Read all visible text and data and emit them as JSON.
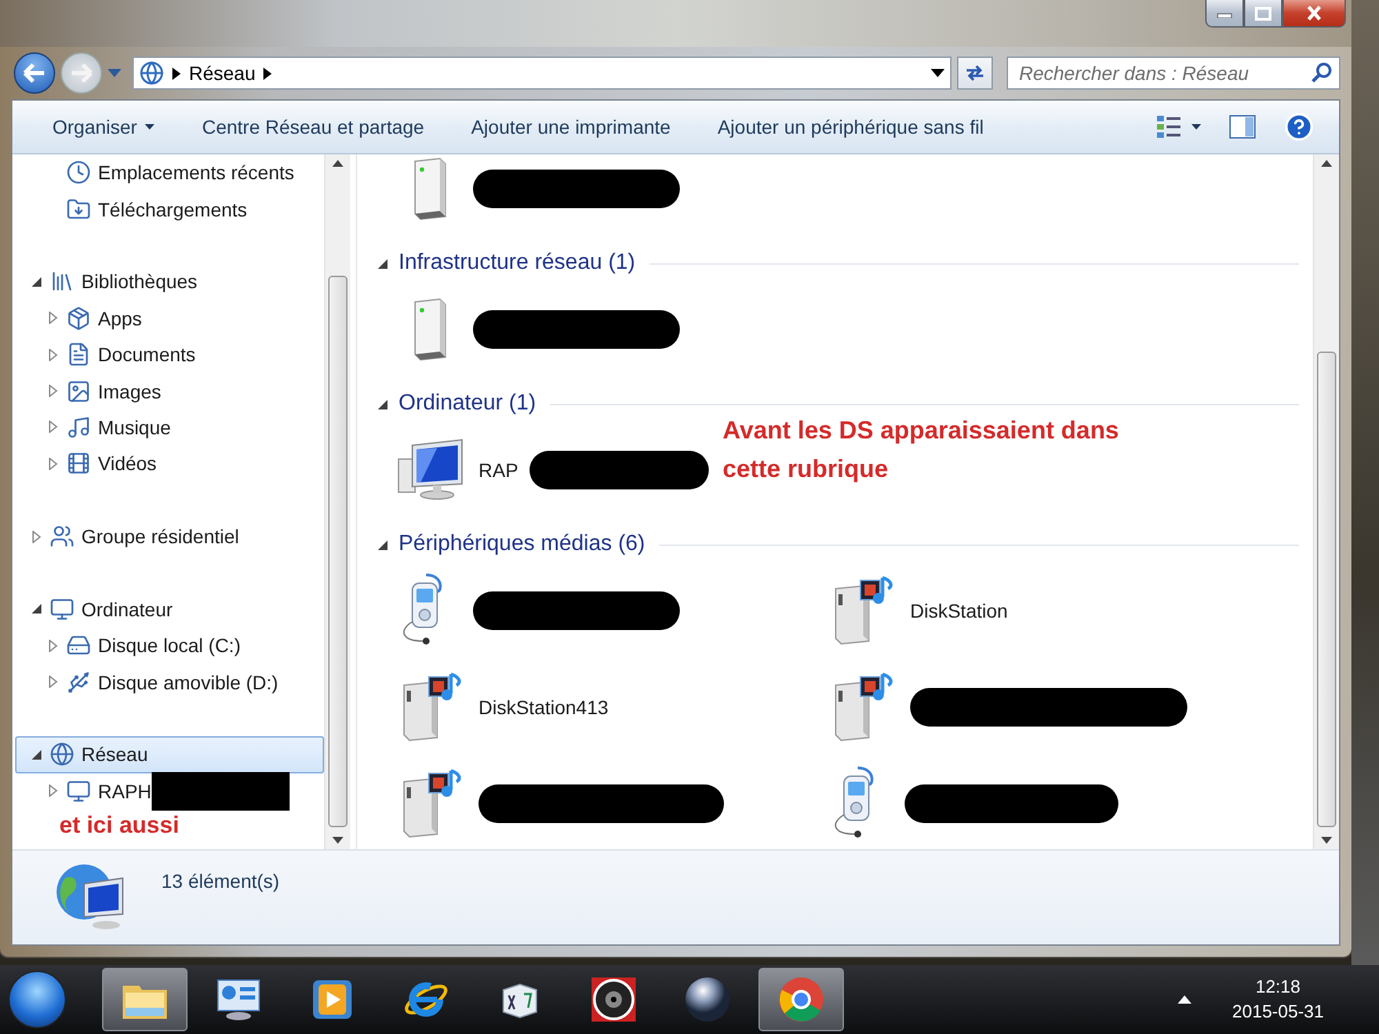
{
  "address_bar": {
    "path": "Réseau"
  },
  "search": {
    "placeholder": "Rechercher dans : Réseau"
  },
  "toolbar": {
    "buttons": [
      {
        "label": "Organiser",
        "kind": "menu"
      },
      {
        "label": "Centre Réseau et partage",
        "kind": "plain"
      },
      {
        "label": "Ajouter une imprimante",
        "kind": "plain"
      },
      {
        "label": "Ajouter un périphérique sans fil",
        "kind": "plain"
      }
    ]
  },
  "sidebar": {
    "sections": [
      {
        "children": [
          {
            "label": "Emplacements récents",
            "selected": false
          },
          {
            "label": "Téléchargements",
            "selected": false
          }
        ]
      },
      {
        "label": "Bibliothèques",
        "expanded": true,
        "selected": false,
        "children": [
          {
            "label": "Apps",
            "expanded": false,
            "selected": false
          },
          {
            "label": "Documents",
            "expanded": false,
            "selected": false
          },
          {
            "label": "Images",
            "expanded": false,
            "selected": false
          },
          {
            "label": "Musique",
            "expanded": false,
            "selected": false
          },
          {
            "label": "Vidéos",
            "expanded": false,
            "selected": false
          }
        ]
      },
      {
        "label": "Groupe résidentiel",
        "expanded": false,
        "selected": false
      },
      {
        "label": "Ordinateur",
        "expanded": true,
        "selected": false,
        "children": [
          {
            "label": "Disque local (C:)",
            "expanded": false,
            "selected": false
          },
          {
            "label": "Disque amovible (D:)",
            "expanded": false,
            "selected": false
          }
        ]
      },
      {
        "label": "Réseau",
        "expanded": true,
        "selected": true,
        "children": [
          {
            "label": "RAPH",
            "expanded": false,
            "selected": false,
            "redacted": true
          }
        ]
      }
    ],
    "annotation": "et ici aussi"
  },
  "content": {
    "groups": [
      {
        "items": [
          {
            "kind": "server",
            "redacted": true
          }
        ]
      },
      {
        "title": "Infrastructure réseau (1)",
        "expanded": true,
        "items": [
          {
            "kind": "server",
            "redacted": true
          }
        ]
      },
      {
        "title": "Ordinateur (1)",
        "expanded": true,
        "items": [
          {
            "kind": "computer",
            "label": "RAP",
            "redacted": true
          }
        ]
      },
      {
        "title": "Périphériques médias (6)",
        "expanded": true,
        "items": [
          {
            "kind": "player",
            "redacted": true
          },
          {
            "kind": "media-server",
            "label": "DiskStation",
            "redacted": false
          },
          {
            "kind": "media-server",
            "label": "DiskStation413",
            "redacted": false
          },
          {
            "kind": "media-server",
            "redacted": true
          },
          {
            "kind": "media-server",
            "redacted": true
          },
          {
            "kind": "player",
            "redacted": true
          }
        ]
      }
    ],
    "annotation": "Avant les DS apparaissaient dans cette rubrique"
  },
  "status_bar": {
    "count": "13 élément(s)"
  },
  "taskbar": {
    "apps": [
      {
        "kind": "folder",
        "selected": true
      },
      {
        "kind": "panel",
        "selected": false
      },
      {
        "kind": "player",
        "selected": false
      },
      {
        "kind": "browser",
        "selected": false
      },
      {
        "kind": "keys",
        "selected": false
      },
      {
        "kind": "disc",
        "selected": false
      },
      {
        "kind": "orb",
        "selected": false
      },
      {
        "kind": "wheel",
        "selected": true
      }
    ],
    "time": "12:18",
    "date": "2015-05-31"
  }
}
